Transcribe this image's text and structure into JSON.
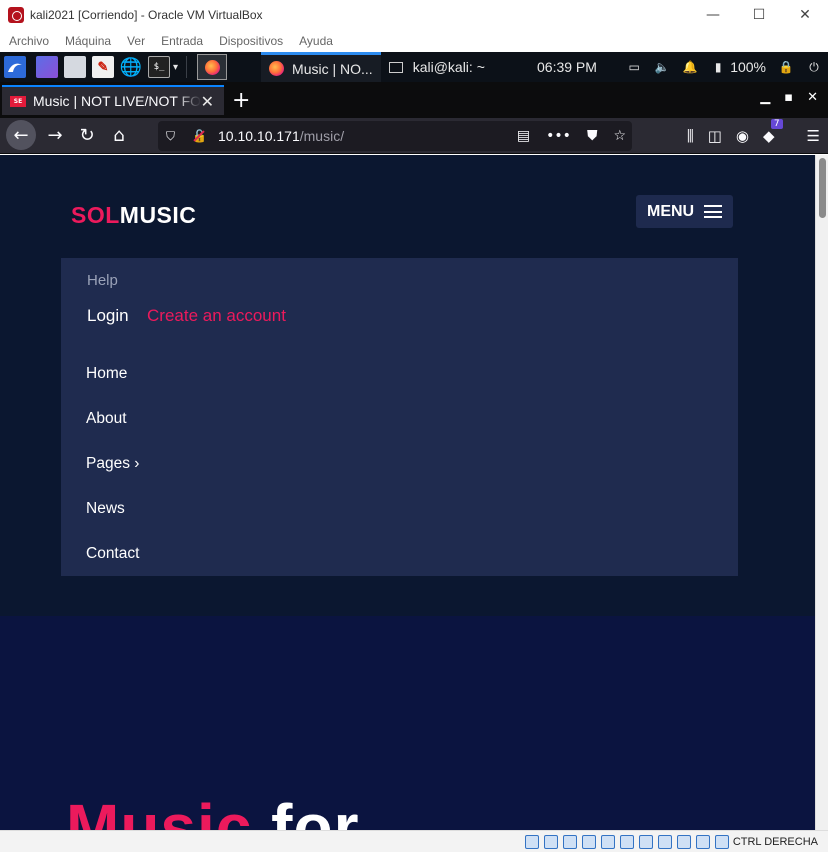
{
  "vbox": {
    "title": "kali2021 [Corriendo] - Oracle VM VirtualBox",
    "menu": [
      "Archivo",
      "Máquina",
      "Ver",
      "Entrada",
      "Dispositivos",
      "Ayuda"
    ],
    "window_controls": {
      "minimize": "—",
      "maximize": "☐",
      "close": "✕"
    },
    "status_host_key": "CTRL DERECHA"
  },
  "kali_panel": {
    "tasks": [
      {
        "label": "Music | NO...",
        "icon": "firefox-icon",
        "active": true
      },
      {
        "label": "kali@kali: ~",
        "icon": "terminal-icon",
        "active": false
      }
    ],
    "clock": "06:39 PM",
    "battery": "100%",
    "term_glyph": "$_"
  },
  "firefox": {
    "tab_title": "Music | NOT LIVE/NOT FOR PRODUCTION USE",
    "favicon_text": "SE",
    "new_tab": "+",
    "url_host": "10.10.10.171",
    "url_path": "/music/",
    "extension_badge": "7"
  },
  "page": {
    "logo_a": "SOL",
    "logo_b": "MUSIC",
    "menu_label": "MENU",
    "help": "Help",
    "login": "Login",
    "create_account": "Create an account",
    "nav": [
      "Home",
      "About",
      "Pages ›",
      "News",
      "Contact"
    ],
    "hero_a": "Music",
    "hero_b": "for"
  },
  "colors": {
    "accent": "#ec1a5c",
    "page_bg": "#0b1730",
    "dropdown_bg": "#1f2b4f",
    "hero_bg": "#0b1440"
  }
}
